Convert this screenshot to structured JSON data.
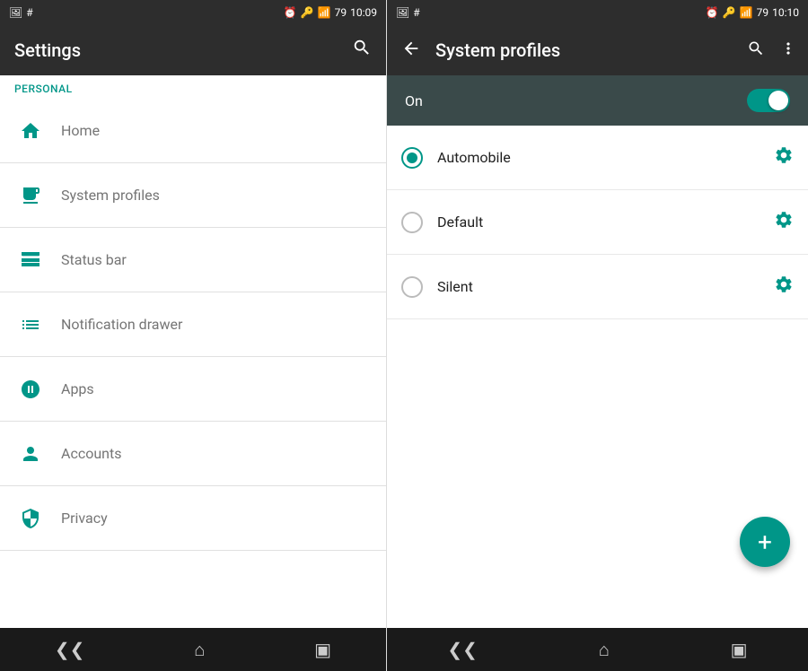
{
  "left": {
    "status_bar": {
      "time": "10:09",
      "icons": [
        "image",
        "hash",
        "alarm",
        "key",
        "signal",
        "battery"
      ]
    },
    "header": {
      "title": "Settings",
      "search_label": "search"
    },
    "personal_label": "Personal",
    "menu_items": [
      {
        "id": "home",
        "label": "Home",
        "icon": "home"
      },
      {
        "id": "system-profiles",
        "label": "System profiles",
        "icon": "system-profiles"
      },
      {
        "id": "status-bar",
        "label": "Status bar",
        "icon": "status-bar"
      },
      {
        "id": "notification-drawer",
        "label": "Notification drawer",
        "icon": "notification-drawer"
      },
      {
        "id": "apps",
        "label": "Apps",
        "icon": "apps"
      },
      {
        "id": "accounts",
        "label": "Accounts",
        "icon": "accounts"
      },
      {
        "id": "privacy",
        "label": "Privacy",
        "icon": "privacy"
      }
    ],
    "nav": {
      "back_label": "back",
      "home_label": "home",
      "recents_label": "recents"
    }
  },
  "right": {
    "status_bar": {
      "time": "10:10",
      "icons": [
        "image",
        "hash",
        "alarm",
        "key",
        "signal",
        "battery"
      ]
    },
    "header": {
      "title": "System profiles",
      "back_label": "back",
      "search_label": "search",
      "more_label": "more options"
    },
    "toggle": {
      "label": "On",
      "state": true
    },
    "profiles": [
      {
        "id": "automobile",
        "label": "Automobile",
        "selected": true
      },
      {
        "id": "default",
        "label": "Default",
        "selected": false
      },
      {
        "id": "silent",
        "label": "Silent",
        "selected": false
      }
    ],
    "fab_label": "+",
    "nav": {
      "back_label": "back",
      "home_label": "home",
      "recents_label": "recents"
    }
  }
}
